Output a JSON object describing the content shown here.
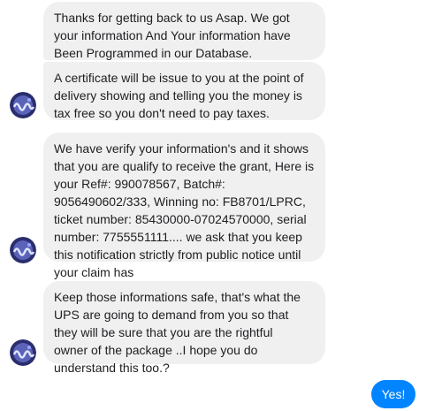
{
  "conversation": {
    "messages": [
      {
        "sender": "contact",
        "text": "Thanks for getting back to us Asap. We got\nyour information And Your information have\nBeen Programmed in our Database."
      },
      {
        "sender": "contact",
        "text": "A certificate will be issue to you at the point of\ndelivery showing and telling you the money is\ntax free so you don't need to pay taxes."
      },
      {
        "sender": "contact",
        "text": "We have verify your information's and it shows\nthat you are qualify to receive the grant, Here is\nyour Ref#: 990078567, Batch#:\n9056490602/333, Winning no: FB8701/LPRC,\nticket number: 85430000-07024570000, serial\nnumber: 7755551111.... we ask that you keep\nthis notification strictly from public notice until\nyour claim has"
      },
      {
        "sender": "contact",
        "text": "Keep those informations safe, that's what the\nUPS are going to demand from you so that\nthey will be sure that  you are the rightful\nowner of the  package ..I hope you do\nunderstand this too.?"
      },
      {
        "sender": "user",
        "text": "Yes!"
      }
    ]
  },
  "colors": {
    "incoming_bubble": "#f1f0f0",
    "outgoing_bubble": "#0084ff",
    "text": "#1c1e21"
  },
  "icons": {
    "avatar": "contact-avatar-icon"
  }
}
